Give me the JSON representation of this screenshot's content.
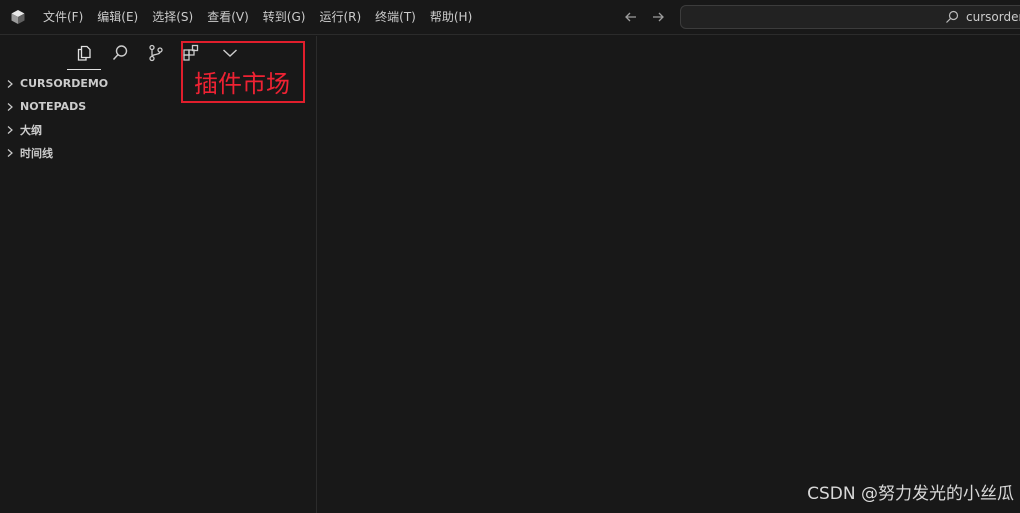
{
  "menu": {
    "items": [
      "文件(F)",
      "编辑(E)",
      "选择(S)",
      "查看(V)",
      "转到(G)",
      "运行(R)",
      "终端(T)",
      "帮助(H)"
    ]
  },
  "search": {
    "value": "cursordemo"
  },
  "activity_bar": {
    "tabs": [
      {
        "name": "explorer",
        "icon": "files-icon",
        "active": true
      },
      {
        "name": "search",
        "icon": "search-icon",
        "active": false
      },
      {
        "name": "source-control",
        "icon": "source-control-icon",
        "active": false
      },
      {
        "name": "extensions",
        "icon": "extensions-icon",
        "active": false
      },
      {
        "name": "more",
        "icon": "chevron-down-icon",
        "active": false
      }
    ]
  },
  "sidebar": {
    "sections": [
      {
        "label": "CURSORDEMO"
      },
      {
        "label": "NOTEPADS"
      },
      {
        "label": "大纲"
      },
      {
        "label": "时间线"
      }
    ]
  },
  "annotation": {
    "label": "插件市场",
    "color": "#e01e2c"
  },
  "watermark": "CSDN @努力发光的小丝瓜",
  "colors": {
    "background": "#181818",
    "border": "#2b2b2b",
    "text": "#cccccc",
    "annotation": "#e01e2c"
  }
}
